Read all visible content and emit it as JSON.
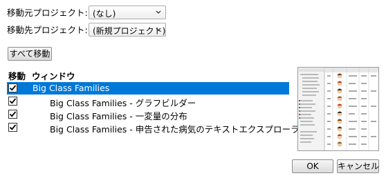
{
  "source_project": {
    "label": "移動元プロジェクト:",
    "value": "(なし)"
  },
  "dest_project": {
    "label": "移動先プロジェクト:",
    "value": "(新規プロジェクト)"
  },
  "move_all_button": "すべて移動",
  "columns": {
    "move": "移動",
    "window": "ウィンドウ"
  },
  "windows": [
    {
      "checked": true,
      "selected": true,
      "indent": 0,
      "label": "Big Class Families"
    },
    {
      "checked": true,
      "selected": false,
      "indent": 1,
      "label": "Big Class Families - グラフビルダー"
    },
    {
      "checked": true,
      "selected": false,
      "indent": 1,
      "label": "Big Class Families - 一変量の分布"
    },
    {
      "checked": true,
      "selected": false,
      "indent": 1,
      "label": "Big Class Families - 申告された病気のテキストエクスプローラ"
    }
  ],
  "preview": {
    "title": "Big Class Families"
  },
  "ok_button": "OK",
  "cancel_button": "キャンセル",
  "colors": {
    "selection": "#0078d7"
  },
  "icons": [
    "chevron-down-icon",
    "checkmark-icon"
  ]
}
